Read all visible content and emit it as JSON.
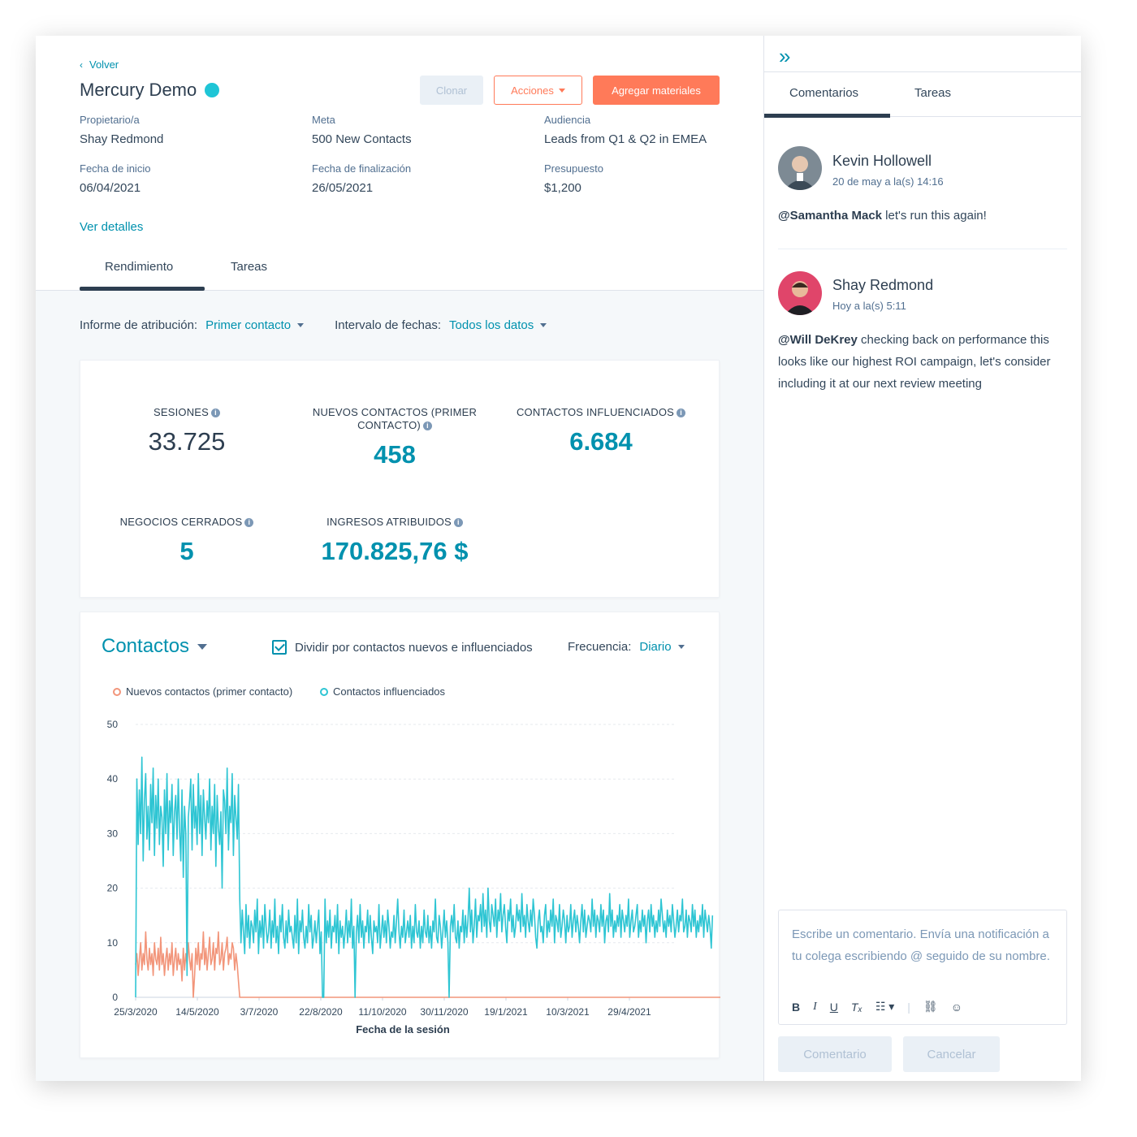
{
  "header": {
    "back_label": "Volver",
    "title": "Mercury Demo",
    "buttons": {
      "clone": "Clonar",
      "actions": "Acciones",
      "add": "Agregar materiales"
    },
    "meta": {
      "owner": {
        "label": "Propietario/a",
        "value": "Shay Redmond"
      },
      "goal": {
        "label": "Meta",
        "value": "500 New Contacts"
      },
      "audience": {
        "label": "Audiencia",
        "value": "Leads from Q1 & Q2 in EMEA"
      },
      "start": {
        "label": "Fecha de inicio",
        "value": "06/04/2021"
      },
      "end": {
        "label": "Fecha de finalización",
        "value": "26/05/2021"
      },
      "budget": {
        "label": "Presupuesto",
        "value": "$1,200"
      }
    },
    "details_link": "Ver detalles",
    "tabs": [
      "Rendimiento",
      "Tareas"
    ]
  },
  "filters": {
    "attribution_label": "Informe de atribución:",
    "attribution_value": "Primer contacto",
    "range_label": "Intervalo de fechas:",
    "range_value": "Todos los datos"
  },
  "stats": {
    "sessions": {
      "label": "SESIONES",
      "value": "33.725"
    },
    "new_contacts": {
      "label": "NUEVOS CONTACTOS (PRIMER CONTACTO)",
      "value": "458"
    },
    "influenced": {
      "label": "CONTACTOS INFLUENCIADOS",
      "value": "6.684"
    },
    "closed_deals": {
      "label": "NEGOCIOS CERRADOS",
      "value": "5"
    },
    "revenue": {
      "label": "INGRESOS ATRIBUIDOS",
      "value": "170.825,76 $"
    }
  },
  "chart_panel": {
    "title": "Contactos",
    "checkbox_label": "Dividir por contactos nuevos e influenciados",
    "frequency_label": "Frecuencia:",
    "frequency_value": "Diario"
  },
  "colors": {
    "accent": "#0091ae",
    "orange": "#ff7a59",
    "influenced": "#2ec5d3",
    "new": "#f2957a"
  },
  "chart_data": {
    "type": "line",
    "xlabel": "Fecha de la sesión",
    "ylabel": "",
    "ylim": [
      0,
      50
    ],
    "yticks": [
      0,
      10,
      20,
      30,
      40,
      50
    ],
    "x_tick_labels": [
      "25/3/2020",
      "14/5/2020",
      "3/7/2020",
      "22/8/2020",
      "11/10/2020",
      "30/11/2020",
      "19/1/2021",
      "10/3/2021",
      "29/4/2021"
    ],
    "x_range": [
      "2020-03-25",
      "2021-05-29"
    ],
    "series": [
      {
        "name": "Nuevos contactos (primer contacto)",
        "color": "#f2957a",
        "x_start": "2020-03-25",
        "step_days": 1,
        "values": [
          6,
          8,
          4,
          7,
          10,
          5,
          8,
          6,
          12,
          7,
          5,
          9,
          6,
          8,
          4,
          10,
          7,
          6,
          9,
          5,
          11,
          6,
          8,
          4,
          7,
          9,
          5,
          8,
          6,
          10,
          4,
          7,
          9,
          5,
          8,
          6,
          7,
          3,
          9,
          5,
          8,
          6,
          10,
          7,
          5,
          8,
          0,
          4,
          9,
          6,
          10,
          5,
          8,
          7,
          12,
          6,
          9,
          5,
          8,
          11,
          6,
          7,
          10,
          5,
          9,
          8,
          12,
          6,
          7,
          10,
          5,
          8,
          9,
          11,
          6,
          8,
          7,
          10,
          9,
          5,
          8,
          6,
          3,
          0,
          0,
          0,
          0,
          0,
          0,
          0,
          0,
          0,
          0,
          0,
          0,
          0,
          0,
          0,
          0,
          0,
          0,
          0,
          0,
          0,
          0,
          0,
          0,
          0,
          0,
          0,
          0,
          0,
          0,
          0,
          0,
          0,
          0,
          0,
          0,
          0,
          0,
          0,
          0,
          0,
          0,
          0,
          0,
          0,
          0,
          0,
          0,
          0,
          0,
          0,
          0,
          0,
          0,
          0,
          0,
          0,
          0,
          0,
          0,
          0,
          0,
          0,
          0,
          0,
          0,
          0,
          0,
          0,
          0,
          0,
          0,
          0,
          0,
          0,
          0,
          0,
          0,
          0,
          0,
          0,
          0,
          0,
          0,
          0,
          0,
          0,
          0,
          0,
          0,
          0,
          0,
          0,
          0,
          0,
          0,
          0,
          0,
          0,
          0,
          0,
          0,
          0,
          0,
          0,
          0,
          0,
          0,
          0,
          0,
          0,
          0,
          0,
          0,
          0,
          0,
          0,
          0,
          0,
          0,
          0,
          0,
          0,
          0,
          0,
          0,
          0,
          0,
          0,
          0,
          0,
          0,
          0,
          0,
          0,
          0,
          0,
          0,
          0,
          0,
          0,
          0,
          0,
          0,
          0,
          0,
          0,
          0,
          0,
          0,
          0,
          0,
          0,
          0,
          0,
          0,
          0,
          0,
          0,
          0,
          0,
          0,
          0,
          0,
          0,
          0,
          0,
          0,
          0,
          0,
          0,
          0,
          0,
          0,
          0,
          0,
          0,
          0,
          0,
          0,
          0,
          0,
          0,
          0,
          0,
          0,
          0,
          0,
          0,
          0,
          0,
          0,
          0,
          0,
          0,
          0,
          0,
          0,
          0,
          0,
          0,
          0,
          0,
          0,
          0,
          0,
          0,
          0,
          0,
          0,
          0,
          0,
          0,
          0,
          0,
          0,
          0,
          0,
          0,
          0,
          0,
          0,
          0,
          0,
          0,
          0,
          0,
          0,
          0,
          0,
          0,
          0,
          0,
          0,
          0,
          0,
          0,
          0,
          0,
          0,
          0,
          0,
          0,
          0,
          0,
          0,
          0,
          0,
          0,
          0,
          0,
          0,
          0,
          0,
          0,
          0,
          0,
          0,
          0,
          0,
          0,
          0,
          0,
          0,
          0,
          0,
          0,
          0,
          0,
          0,
          0,
          0,
          0,
          0,
          0,
          0,
          0,
          0,
          0,
          0,
          0,
          0,
          0,
          0,
          0,
          0,
          0,
          0,
          0,
          0,
          0,
          0,
          0,
          0,
          0,
          0,
          0,
          0,
          0,
          0,
          0,
          0,
          0,
          0,
          0,
          0,
          0,
          0,
          0,
          0,
          0,
          0,
          0,
          0,
          0,
          0,
          0,
          0,
          0,
          0,
          0,
          0,
          0,
          0,
          0,
          0,
          0,
          0,
          0,
          0,
          0,
          0,
          0,
          0,
          0,
          0,
          0,
          0,
          0,
          0,
          0,
          0,
          0,
          0,
          0,
          0,
          0,
          0,
          0,
          0,
          0,
          0,
          0,
          0,
          0,
          0,
          0,
          0,
          0,
          0,
          0,
          0,
          0,
          0,
          0,
          0,
          0,
          0,
          0,
          0,
          0,
          0,
          0,
          0,
          0,
          0,
          0,
          0,
          0,
          0,
          0,
          0,
          0,
          0,
          0,
          0,
          0,
          0,
          0,
          0,
          0,
          0,
          0,
          0,
          0,
          0,
          0,
          0,
          0,
          0,
          0,
          0,
          0,
          0,
          0,
          0,
          0,
          0,
          0,
          0,
          0,
          0,
          0,
          0,
          0,
          0
        ]
      },
      {
        "name": "Contactos influenciados",
        "color": "#2ec5d3",
        "x_start": "2020-03-25",
        "step_days": 1,
        "values": [
          0,
          40,
          28,
          38,
          30,
          44,
          25,
          36,
          41,
          29,
          35,
          27,
          39,
          32,
          42,
          26,
          37,
          31,
          40,
          28,
          35,
          33,
          24,
          38,
          30,
          41,
          27,
          36,
          32,
          39,
          26,
          34,
          37,
          29,
          40,
          31,
          25,
          38,
          22,
          35,
          30,
          4,
          33,
          36,
          40,
          27,
          39,
          31,
          35,
          28,
          41,
          30,
          37,
          26,
          38,
          33,
          29,
          36,
          32,
          40,
          27,
          35,
          30,
          39,
          24,
          37,
          31,
          28,
          34,
          20,
          38,
          36,
          30,
          42,
          27,
          35,
          32,
          41,
          26,
          37,
          33,
          29,
          39,
          18,
          10,
          16,
          12,
          8,
          17,
          11,
          15,
          9,
          14,
          13,
          10,
          16,
          12,
          18,
          8,
          14,
          11,
          15,
          9,
          17,
          13,
          10,
          12,
          16,
          9,
          14,
          11,
          18,
          10,
          13,
          8,
          15,
          12,
          17,
          11,
          9,
          14,
          10,
          16,
          12,
          13,
          11,
          9,
          15,
          10,
          18,
          8,
          14,
          12,
          16,
          11,
          9,
          13,
          10,
          17,
          12,
          15,
          9,
          11,
          14,
          10,
          13,
          16,
          8,
          12,
          0,
          0,
          18,
          10,
          14,
          11,
          16,
          9,
          13,
          12,
          15,
          10,
          17,
          8,
          14,
          11,
          13,
          9,
          12,
          16,
          10,
          14,
          11,
          18,
          9,
          13,
          0,
          12,
          15,
          10,
          17,
          11,
          14,
          9,
          13,
          12,
          16,
          10,
          15,
          11,
          8,
          14,
          12,
          13,
          10,
          17,
          9,
          12,
          15,
          11,
          14,
          10,
          16,
          13,
          9,
          12,
          11,
          15,
          10,
          14,
          18,
          12,
          9,
          13,
          11,
          16,
          10,
          12,
          14,
          11,
          15,
          9,
          13,
          10,
          17,
          12,
          11,
          14,
          9,
          13,
          10,
          16,
          12,
          11,
          15,
          10,
          13,
          9,
          14,
          12,
          18,
          11,
          10,
          15,
          13,
          9,
          12,
          16,
          11,
          14,
          10,
          0,
          13,
          15,
          12,
          17,
          11,
          10,
          14,
          9,
          13,
          12,
          16,
          10,
          15,
          11,
          14,
          20,
          12,
          16,
          10,
          13,
          18,
          11,
          15,
          14,
          17,
          12,
          19,
          13,
          16,
          11,
          20,
          14,
          12,
          17,
          15,
          13,
          18,
          11,
          16,
          14,
          19,
          12,
          15,
          17,
          13,
          10,
          16,
          14,
          18,
          12,
          15,
          11,
          13,
          17,
          14,
          16,
          12,
          19,
          13,
          15,
          11,
          17,
          14,
          12,
          16,
          13,
          18,
          15,
          11,
          9,
          14,
          16,
          12,
          13,
          10,
          15,
          17,
          11,
          14,
          12,
          16,
          13,
          18,
          10,
          15,
          14,
          12,
          17,
          11,
          13,
          16,
          14,
          10,
          15,
          12,
          13,
          17,
          11,
          14,
          16,
          12,
          15,
          13,
          10,
          14,
          17,
          12,
          16,
          11,
          13,
          15,
          14,
          12,
          18,
          13,
          16,
          11,
          15,
          14,
          12,
          17,
          13,
          16,
          10,
          14,
          15,
          12,
          19,
          13,
          16,
          11,
          14,
          12,
          15,
          13,
          17,
          11,
          16,
          14,
          12,
          15,
          13,
          18,
          11,
          14,
          16,
          12,
          13,
          15,
          17,
          11,
          14,
          12,
          16,
          13,
          15,
          10,
          14,
          16,
          12,
          17,
          13,
          15,
          11,
          14,
          12,
          16,
          13,
          18,
          15,
          12,
          14,
          11,
          16,
          13,
          15,
          12,
          17,
          14,
          11,
          13,
          16,
          12,
          15,
          14,
          18,
          12,
          13,
          16,
          11,
          15,
          14,
          12,
          17,
          13,
          16,
          11,
          14,
          12,
          15,
          13,
          17,
          11,
          16,
          14,
          12,
          15,
          13,
          9,
          15
        ]
      }
    ]
  },
  "sidebar": {
    "tabs": [
      "Comentarios",
      "Tareas"
    ],
    "comments": [
      {
        "author": "Kevin Hollowell",
        "date": "20 de may a la(s) 14:16",
        "mention": "@Samantha Mack",
        "text": " let's run this again!"
      },
      {
        "author": "Shay Redmond",
        "date": "Hoy a la(s) 5:11",
        "mention": "@Will DeKrey",
        "text": " checking back on performance this looks like our highest ROI campaign, let's consider including it at our next review meeting"
      }
    ],
    "editor_placeholder": "Escribe un comentario. Envía una notificación a tu colega escribiendo @ seguido de su nombre.",
    "buttons": {
      "comment": "Comentario",
      "cancel": "Cancelar"
    }
  }
}
